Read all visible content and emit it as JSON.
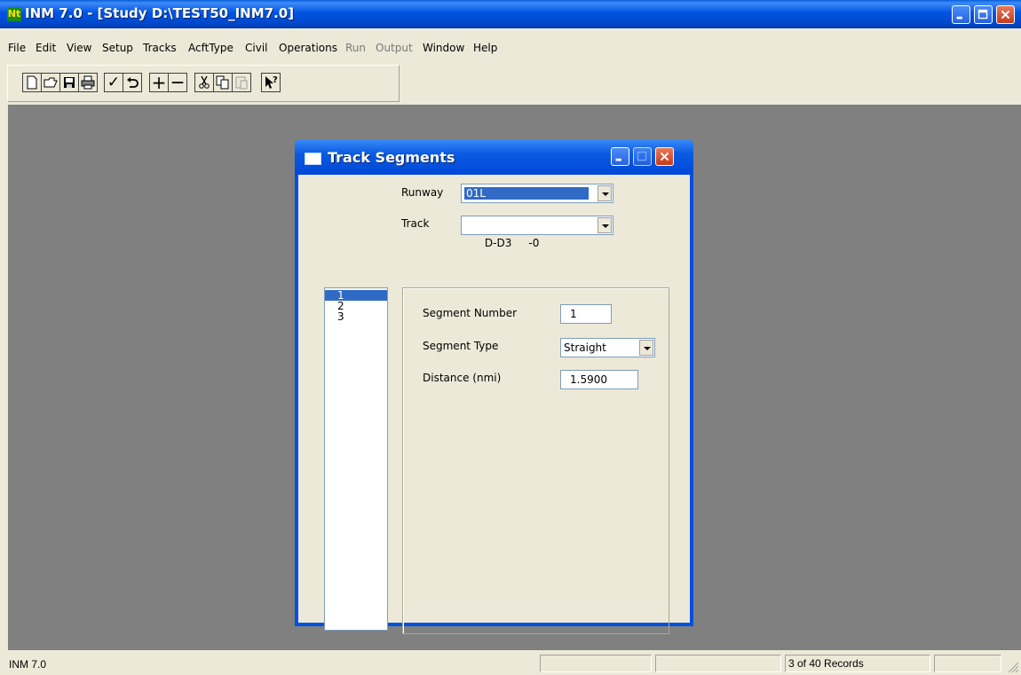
{
  "window": {
    "app_icon": "Nt",
    "title": "INM 7.0 - [Study D:\\TEST50_INM7.0]"
  },
  "menu": {
    "file": "File",
    "edit": "Edit",
    "view": "View",
    "setup": "Setup",
    "tracks": "Tracks",
    "acfttype": "AcftType",
    "civil": "Civil",
    "operations": "Operations",
    "run": "Run",
    "output": "Output",
    "window": "Window",
    "help": "Help"
  },
  "toolbar": {
    "icons": [
      "new-file-icon",
      "open-folder-icon",
      "save-icon",
      "print-icon",
      "check-icon",
      "undo-icon",
      "add-icon",
      "remove-icon",
      "cut-icon",
      "copy-icon",
      "paste-icon",
      "context-help-icon"
    ],
    "check": "✓",
    "add": "+",
    "remove": "—",
    "help": "?"
  },
  "dialog": {
    "title": "Track Segments",
    "runway_label": "Runway",
    "runway_value": "01L",
    "track_label": "Track",
    "track_value": "D-D3     -0",
    "segments": [
      "1",
      "2",
      "3"
    ],
    "selected_segment": "1",
    "segment_number_label": "Segment Number",
    "segment_number_value": "1",
    "segment_type_label": "Segment Type",
    "segment_type_value": "Straight",
    "distance_label": "Distance (nmi)",
    "distance_value": "1.5900"
  },
  "status": {
    "left_text": "INM 7.0",
    "records": "3 of 40 Records"
  },
  "colors": {
    "titlebar": "#0054e3",
    "mdi_background": "#808080",
    "selection": "#316ac5",
    "close_button": "#c53b1b"
  }
}
